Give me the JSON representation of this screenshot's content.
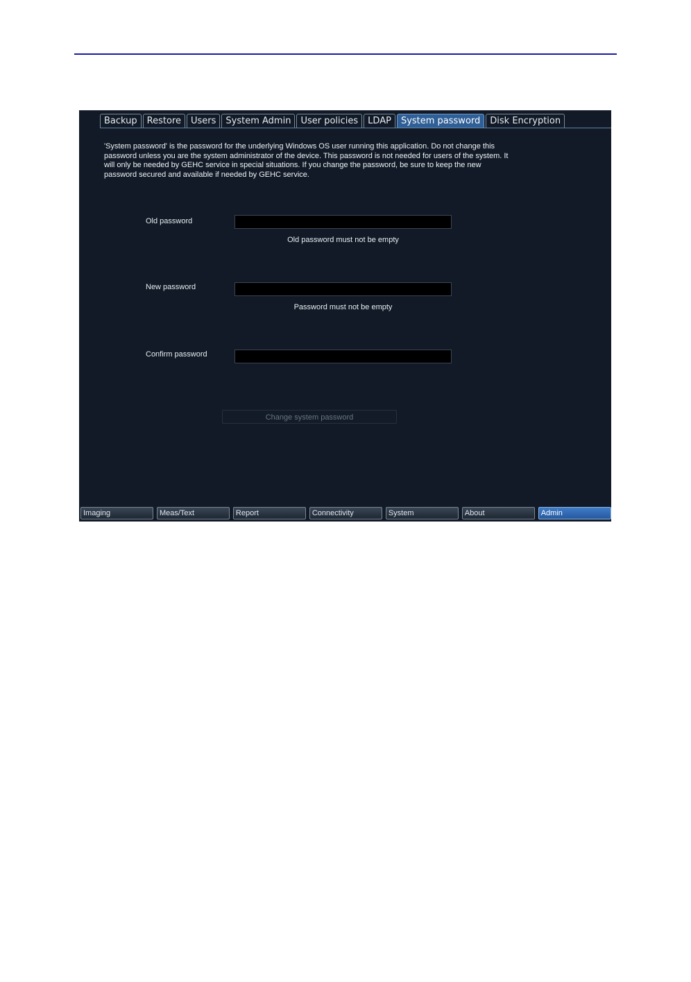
{
  "tabs": [
    {
      "label": "Backup"
    },
    {
      "label": "Restore"
    },
    {
      "label": "Users"
    },
    {
      "label": "System Admin"
    },
    {
      "label": "User policies"
    },
    {
      "label": "LDAP"
    },
    {
      "label": "System password",
      "active": true
    },
    {
      "label": "Disk Encryption"
    }
  ],
  "description": "'System password' is the password for the underlying Windows OS user running this application. Do not change this password unless you are the system administrator of the device. This password is not needed for users of the system. It will only be needed by GEHC service in special situations. If you change the password, be sure to keep the new password secured and available if needed by GEHC service.",
  "fields": {
    "old_password": {
      "label": "Old password",
      "value": "",
      "error": "Old password must not be empty"
    },
    "new_password": {
      "label": "New password",
      "value": "",
      "error": "Password must not be empty"
    },
    "confirm_password": {
      "label": "Confirm password",
      "value": ""
    }
  },
  "change_button": {
    "label": "Change system password",
    "enabled": false
  },
  "bottom_nav": [
    {
      "label": "Imaging"
    },
    {
      "label": "Meas/Text"
    },
    {
      "label": "Report"
    },
    {
      "label": "Connectivity"
    },
    {
      "label": "System"
    },
    {
      "label": "About"
    },
    {
      "label": "Admin",
      "active": true
    }
  ],
  "colors": {
    "panel_background": "#111a26",
    "active_tab": "#2f5f96",
    "active_nav": "#2f6cb8",
    "header_rule": "#1a1aa6"
  }
}
